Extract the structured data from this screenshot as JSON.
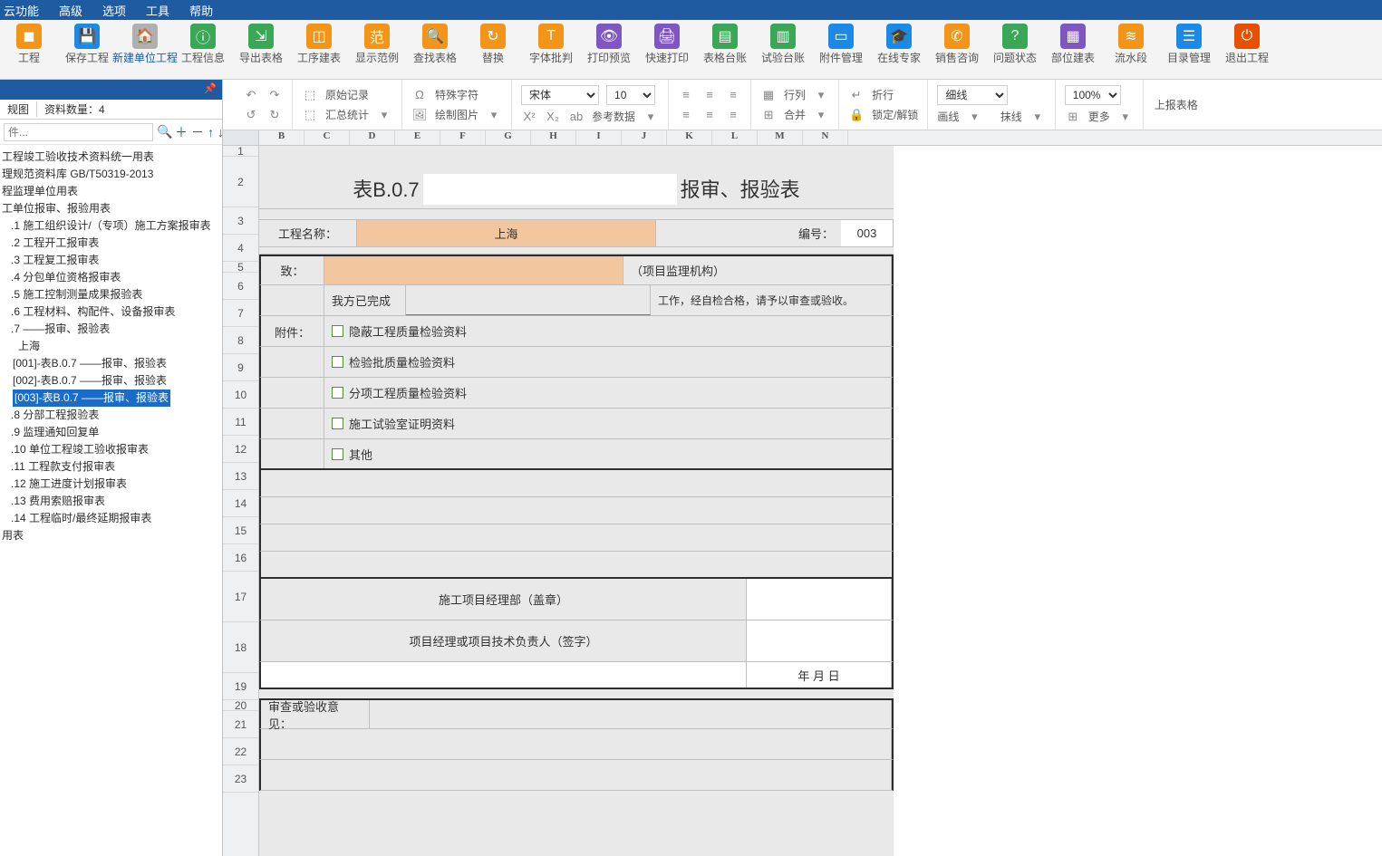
{
  "menu": {
    "items": [
      "云功能",
      "高级",
      "选项",
      "工具",
      "帮助"
    ]
  },
  "ribbon": [
    {
      "label": "工程",
      "icon": "◼",
      "bg": "bg-orange"
    },
    {
      "label": "保存工程",
      "icon": "💾",
      "bg": "bg-blue"
    },
    {
      "label": "新建单位工程",
      "icon": "🏠",
      "bg": "bg-grey",
      "sel": true
    },
    {
      "label": "工程信息",
      "icon": "ⓘ",
      "bg": "bg-green"
    },
    {
      "label": "导出表格",
      "icon": "⇲",
      "bg": "bg-green"
    },
    {
      "label": "工序建表",
      "icon": "◫",
      "bg": "bg-orange"
    },
    {
      "label": "显示范例",
      "icon": "范",
      "bg": "bg-orange"
    },
    {
      "label": "查找表格",
      "icon": "🔍",
      "bg": "bg-orange"
    },
    {
      "label": "替换",
      "icon": "↻",
      "bg": "bg-orange"
    },
    {
      "label": "字体批判",
      "icon": "T",
      "bg": "bg-orange"
    },
    {
      "label": "打印预览",
      "icon": "👁",
      "bg": "bg-purple"
    },
    {
      "label": "快速打印",
      "icon": "🖨",
      "bg": "bg-purple"
    },
    {
      "label": "表格台账",
      "icon": "▤",
      "bg": "bg-green"
    },
    {
      "label": "试验台账",
      "icon": "▥",
      "bg": "bg-green"
    },
    {
      "label": "附件管理",
      "icon": "▭",
      "bg": "bg-blue"
    },
    {
      "label": "在线专家",
      "icon": "🎓",
      "bg": "bg-blue"
    },
    {
      "label": "销售咨询",
      "icon": "✆",
      "bg": "bg-orange"
    },
    {
      "label": "问题状态",
      "icon": "?",
      "bg": "bg-green"
    },
    {
      "label": "部位建表",
      "icon": "▦",
      "bg": "bg-purple"
    },
    {
      "label": "流水段",
      "icon": "≋",
      "bg": "bg-orange"
    },
    {
      "label": "目录管理",
      "icon": "☰",
      "bg": "bg-blue"
    },
    {
      "label": "退出工程",
      "icon": "⏻",
      "bg": "bg-red"
    }
  ],
  "tool2": {
    "raw": "原始记录",
    "total": "汇总统计",
    "spchar": "特殊字符",
    "refdata": "参考数据",
    "drawpic": "绘制图片",
    "font": "宋体",
    "size": "10",
    "rows": "行列",
    "merge": "合并",
    "fold": "折行",
    "lock": "锁定/解锁",
    "line": "细线",
    "zoom": "100%",
    "more": "更多",
    "upload": "上报表格",
    "style1": "画线",
    "style2": "抹线"
  },
  "leftPanel": {
    "tab1": "规图",
    "count": "资料数量：4",
    "searchPlaceholder": "件...",
    "tree": [
      "工程竣工验收技术资料统一用表",
      "理规范资料库 GB/T50319-2013",
      "程监理单位用表",
      "工单位报审、报验用表",
      ".1 施工组织设计/（专项）施工方案报审表",
      ".2 工程开工报审表",
      ".3 工程复工报审表",
      ".4 分包单位资格报审表",
      ".5 施工控制测量成果报验表",
      ".6 工程材料、构配件、设备报审表",
      ".7 ——报审、报验表",
      "上海",
      "[001]-表B.0.7 ——报审、报验表",
      "[002]-表B.0.7 ——报审、报验表",
      "[003]-表B.0.7 ——报审、报验表",
      ".8 分部工程报验表",
      ".9 监理通知回复单",
      ".10 单位工程竣工验收报审表",
      ".11 工程款支付报审表",
      ".12 施工进度计划报审表",
      ".13 费用索赔报审表",
      ".14 工程临时/最终延期报审表",
      "用表"
    ],
    "selectedIndex": 14
  },
  "sheet": {
    "cols": [
      "B",
      "C",
      "D",
      "E",
      "F",
      "G",
      "H",
      "I",
      "J",
      "K",
      "L",
      "M",
      "N"
    ],
    "rows": [
      "1",
      "2",
      "3",
      "4",
      "5",
      "6",
      "7",
      "8",
      "9",
      "10",
      "11",
      "12",
      "13",
      "14",
      "15",
      "16",
      "17",
      "18",
      "19",
      "20",
      "21",
      "22",
      "23"
    ],
    "titlePrefix": "表B.0.7",
    "titleSuffix": "报审、报验表",
    "projName": "工程名称：",
    "projVal": "上海",
    "numLbl": "编号：",
    "numVal": "003",
    "to": "致：",
    "toSuffix": "（项目监理机构）",
    "done1": "我方已完成",
    "done2": "工作，经自检合格，请予以审查或验收。",
    "att": "附件：",
    "chk": [
      "隐蔽工程质量检验资料",
      "检验批质量检验资料",
      "分项工程质量检验资料",
      "施工试验室证明资料",
      "其他"
    ],
    "sign1": "施工项目经理部（盖章）",
    "sign2": "项目经理或项目技术负责人（签字）",
    "date": "年    月    日",
    "opinion": "审查或验收意见："
  }
}
